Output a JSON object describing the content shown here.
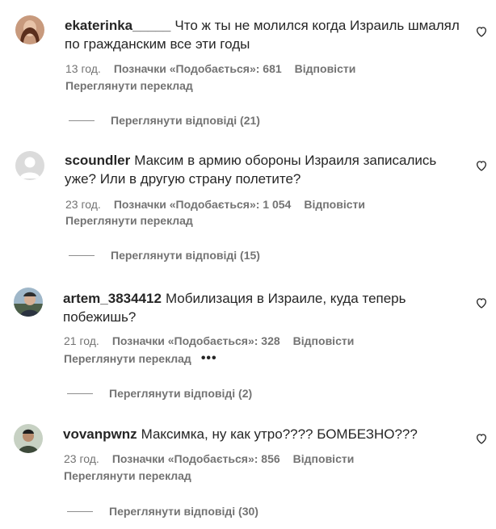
{
  "ui": {
    "translate_label": "Переглянути переклад",
    "reply_label": "Відповісти"
  },
  "comments": [
    {
      "username": "ekaterinka_____",
      "text": "Что ж ты не молился когда Израиль шмалял по гражданским все эти годы",
      "time": "13 год.",
      "likes": "Позначки «Подобається»: 681",
      "view_replies": "Переглянути відповіді (21)",
      "avatar_color": "#7a4a35"
    },
    {
      "username": "scoundler",
      "text": "Максим в армию обороны Израиля записались уже? Или в другую страну полетите?",
      "time": "23 год.",
      "likes": "Позначки «Подобається»: 1 054",
      "view_replies": "Переглянути відповіді (15)",
      "avatar_color": "#dbdbdb"
    },
    {
      "username": "artem_3834412",
      "text": "Мобилизация в Израиле, куда теперь побежишь?",
      "time": "21 год.",
      "likes": "Позначки «Подобається»: 328",
      "more": "•••",
      "view_replies": "Переглянути відповіді (2)",
      "avatar_color": "#6b8aa8"
    },
    {
      "username": "vovanpwnz",
      "text": "Максимка, ну как утро???? БОМБЕЗНО???",
      "time": "23 год.",
      "likes": "Позначки «Подобається»: 856",
      "view_replies": "Переглянути відповіді (30)",
      "avatar_color": "#3d4a3a"
    }
  ]
}
